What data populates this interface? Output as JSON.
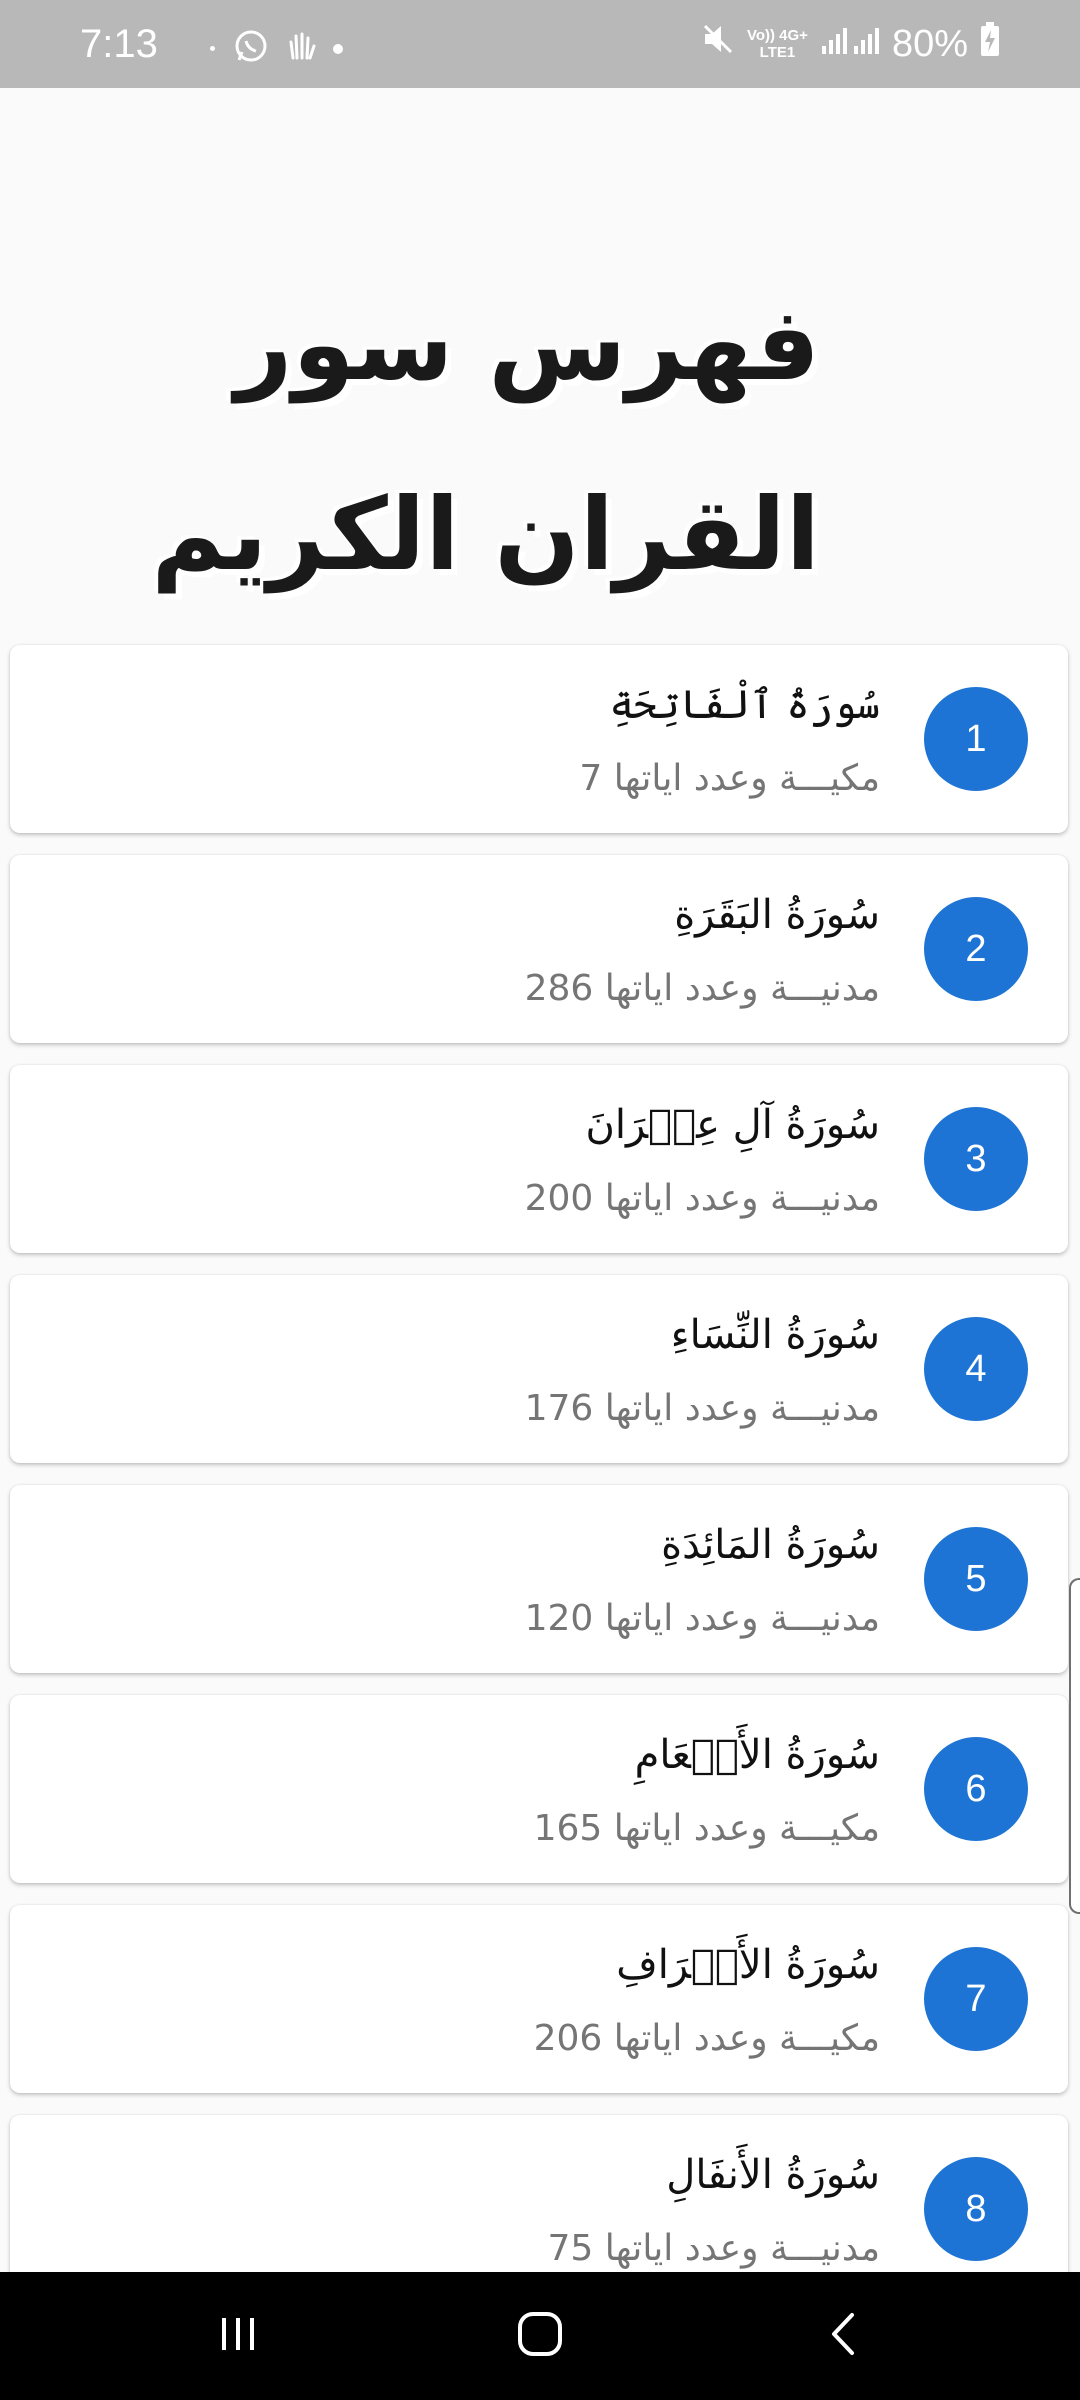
{
  "status_bar": {
    "time": "7:13",
    "network": "VoLTE1 4G+",
    "network_line1": "Vo)) 4G+",
    "network_line2": "LTE1",
    "battery": "80%"
  },
  "header": {
    "title": "فهرس سور القران الكريم"
  },
  "surahs": [
    {
      "number": "1",
      "name": "سُورَةُ ٱلْفَاتِحَةِ",
      "meta": "مكيـــة وعدد اياتها 7"
    },
    {
      "number": "2",
      "name": "سُورَةُ البَقَرَةِ",
      "meta": "مدنيـــة وعدد اياتها 286"
    },
    {
      "number": "3",
      "name": "سُورَةُ آلِ عِمۡرَانَ",
      "meta": "مدنيـــة وعدد اياتها 200"
    },
    {
      "number": "4",
      "name": "سُورَةُ النِّسَاءِ",
      "meta": "مدنيـــة وعدد اياتها 176"
    },
    {
      "number": "5",
      "name": "سُورَةُ المَائِدَةِ",
      "meta": "مدنيـــة وعدد اياتها 120"
    },
    {
      "number": "6",
      "name": "سُورَةُ الأَنۡعَامِ",
      "meta": "مكيـــة وعدد اياتها 165"
    },
    {
      "number": "7",
      "name": "سُورَةُ الأَعۡرَافِ",
      "meta": "مكيـــة وعدد اياتها 206"
    },
    {
      "number": "8",
      "name": "سُورَةُ الأَنفَالِ",
      "meta": "مدنيـــة وعدد اياتها 75"
    }
  ],
  "icons": {
    "status": [
      "whatsapp-icon",
      "wave-hand-icon",
      "mute-icon",
      "signal-icon",
      "battery-charging-icon"
    ],
    "nav": [
      "recent-apps-icon",
      "home-icon",
      "back-icon"
    ]
  },
  "colors": {
    "accent": "#1e74d4",
    "status_bar": "#b8b8b8",
    "background": "#fafafa",
    "nav_bar": "#000000"
  }
}
